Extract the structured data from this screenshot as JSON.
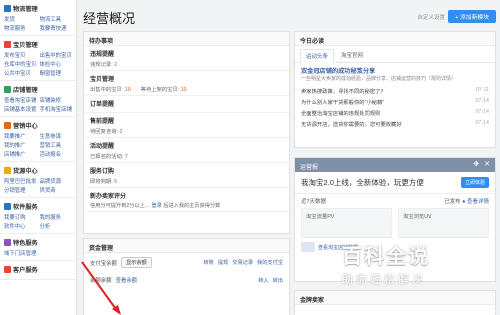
{
  "sidebar": {
    "sections": [
      {
        "title": "物流管理",
        "color": "#2a74c8",
        "links": [
          "发货",
          "物流工具",
          "物流服务",
          "我要寄快递"
        ]
      },
      {
        "title": "宝贝管理",
        "color": "#e8472f",
        "links": [
          "发布宝贝",
          "出售中的宝贝",
          "仓库中的宝贝",
          "体检中心",
          "公共中宝贝",
          "橱窗管理"
        ]
      },
      {
        "title": "店铺管理",
        "color": "#29a35c",
        "links": [
          "查看淘宝店铺",
          "店铺装修",
          "店铺基本设置",
          "手机淘宝店铺"
        ]
      },
      {
        "title": "营销中心",
        "color": "#e06a1b",
        "links": [
          "我要推广",
          "生意参谋",
          "我的推广",
          "营销工具",
          "店铺推广",
          "活动报名"
        ]
      },
      {
        "title": "货源中心",
        "color": "#f0a51f",
        "links": [
          "阿里巴巴批发",
          "品牌货源",
          "分销管理",
          "供货商"
        ]
      },
      {
        "title": "软件服务",
        "color": "#2a74c8",
        "links": [
          "我要订购",
          "我的服务",
          "软件中心",
          "分析"
        ]
      },
      {
        "title": "特色服务",
        "color": "#8a52c4",
        "links": [
          "域下门店管理"
        ]
      },
      {
        "title": "客户服务",
        "color": "#e8472f",
        "links": []
      }
    ]
  },
  "header": {
    "title": "经营概况",
    "customize_label": "自定义设置",
    "add_label": "+ 添加新模块"
  },
  "todo": {
    "title": "待办事项",
    "blocks": [
      {
        "title": "违规提醒",
        "items": [
          {
            "label": "违规记录:",
            "value": "2"
          }
        ]
      },
      {
        "title": "宝贝管理",
        "items": [
          {
            "label": "出售中的宝贝:",
            "value": "10"
          },
          {
            "label": "等待上架的宝贝:",
            "value": "10"
          }
        ]
      },
      {
        "title": "订单提醒",
        "items": []
      },
      {
        "title": "售前提醒",
        "items": [
          {
            "label": "待回复咨询:",
            "value": "2"
          }
        ]
      },
      {
        "title": "活动提醒",
        "items": [
          {
            "label": "已报名的活动:",
            "value": "7"
          }
        ]
      },
      {
        "title": "服务订购",
        "items": [
          {
            "label": "即将到期:",
            "value": "5"
          }
        ]
      }
    ],
    "credit": {
      "title": "新办卖家评分",
      "note": "信用分可提升到2分以上…",
      "link": "登录",
      "note2": "后进入我的主页获得分数"
    }
  },
  "funds": {
    "title": "资金管理",
    "alipay_label": "支付宝余额",
    "show_btn": "显示余额",
    "links": [
      "转账",
      "提现",
      "交易记录",
      "我的支付宝"
    ],
    "row2_label": "余额余额",
    "row2_link": "查看余额",
    "actions": [
      "转入",
      "转出"
    ]
  },
  "news": {
    "title": "今日必读",
    "tabs": [
      "运动头条",
      "淘宝官网"
    ],
    "lead_title": "双金冠店铺的成功秘笈分享",
    "lead_text": "一些明星大卖家的成功经验，品牌分享、店铺运营的技巧（规则详情）",
    "items": [
      {
        "text": "卖家热搜政策，寻找不同的秘密了？",
        "date": "07-11"
      },
      {
        "text": "为什么别人家干货那般你的\"小秘籍\"",
        "date": "07-14"
      },
      {
        "text": "全面整治淘宝店铺的违规处罚规则",
        "date": "07-14"
      },
      {
        "text": "无货源开店，选货你需要的，您可要收藏好",
        "date": "07-14"
      }
    ]
  },
  "ops": {
    "title": "运营报",
    "banner": "我淘宝2.0上线，全新体验，玩更方便",
    "banner_btn": "立即体验",
    "range_label": "近7天数据",
    "range_status": "已发布",
    "range_link": "● 查看详情",
    "metrics": [
      {
        "label": "淘宝流量PV",
        "value": ""
      },
      {
        "label": "淘宝浏览UV",
        "value": ""
      }
    ],
    "foot_link": "查看淘宝店铺数据"
  },
  "gold": {
    "title": "金牌卖家"
  },
  "watermark": {
    "main": "百科全说",
    "sub": "助你轻松解决"
  }
}
